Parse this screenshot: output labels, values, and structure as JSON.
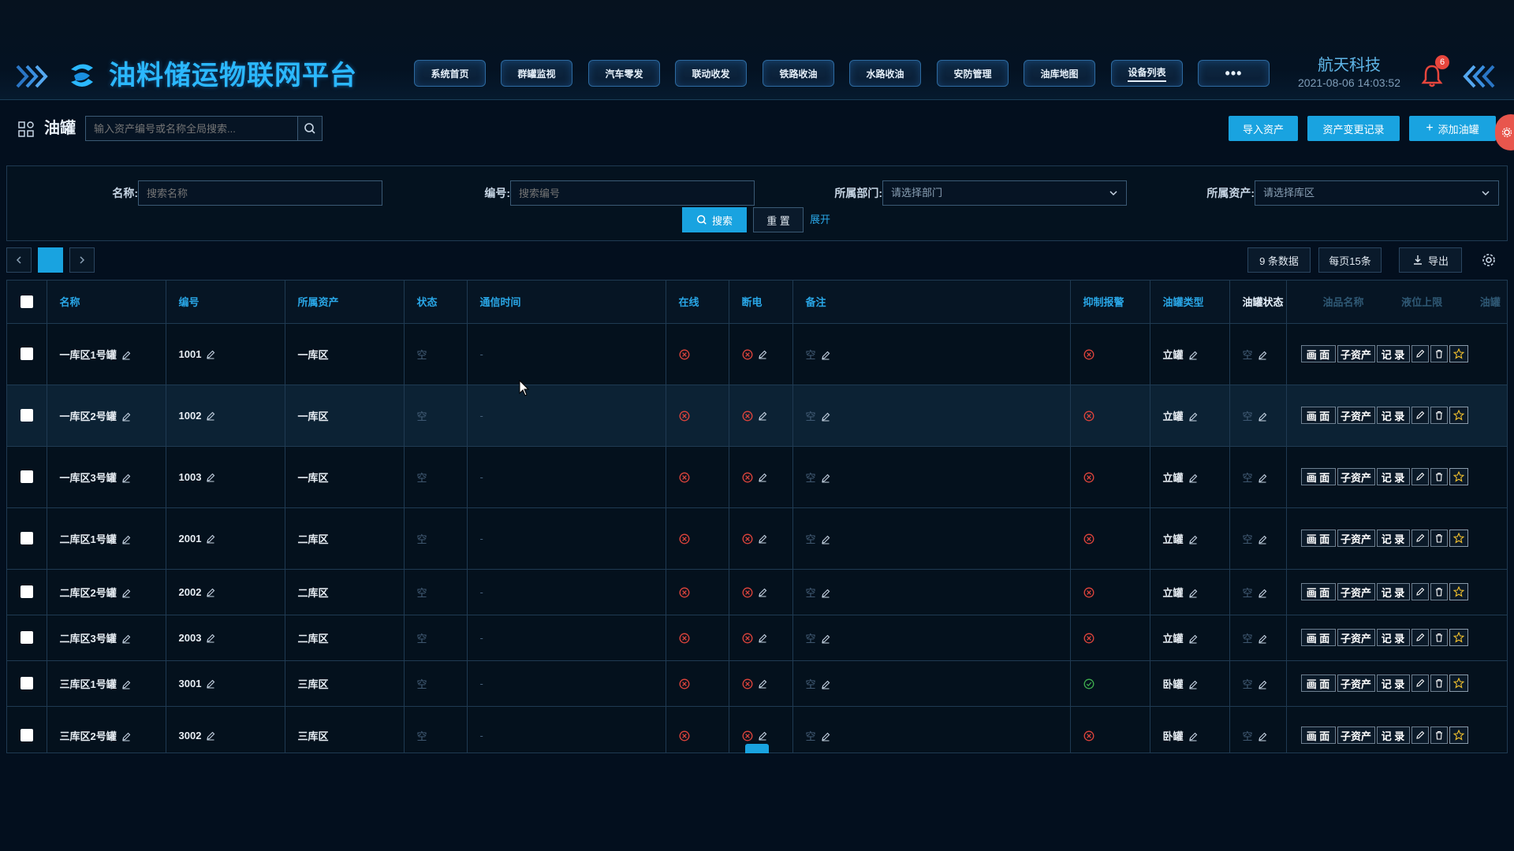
{
  "header": {
    "app_title": "油料储运物联网平台",
    "nav": [
      {
        "label": "系统首页"
      },
      {
        "label": "群罐监视"
      },
      {
        "label": "汽车零发"
      },
      {
        "label": "联动收发"
      },
      {
        "label": "铁路收油"
      },
      {
        "label": "水路收油"
      },
      {
        "label": "安防管理"
      },
      {
        "label": "油库地图"
      },
      {
        "label": "设备列表",
        "active": true
      },
      {
        "label": "•••"
      }
    ],
    "company": "航天科技",
    "datetime": "2021-08-06 14:03:52",
    "notification_count": "6"
  },
  "toolbar": {
    "page_title": "油罐",
    "global_search_placeholder": "输入资产编号或名称全局搜索...",
    "import_label": "导入资产",
    "change_log_label": "资产变更记录",
    "add_label": "添加油罐"
  },
  "filters": {
    "name_label": "名称:",
    "name_placeholder": "搜索名称",
    "code_label": "编号:",
    "code_placeholder": "搜索编号",
    "dept_label": "所属部门:",
    "dept_placeholder": "请选择部门",
    "asset_label": "所属资产:",
    "asset_placeholder": "请选择库区",
    "search_label": "搜索",
    "reset_label": "重 置",
    "expand_label": "展开"
  },
  "pager": {
    "total_label": "9 条数据",
    "page_size_label": "每页15条",
    "export_label": "导出"
  },
  "table": {
    "headers": {
      "name": "名称",
      "code": "编号",
      "asset": "所属资产",
      "status": "状态",
      "comm_time": "通信时间",
      "online": "在线",
      "power_off": "断电",
      "remark": "备注",
      "suppress_alarm": "抑制报警",
      "tank_type": "油罐类型",
      "tank_status": "油罐状态",
      "oil_name": "油品名称",
      "level_upper": "液位上限",
      "extra": "油罐"
    },
    "empty_text": "空",
    "dash_text": "-",
    "ops": {
      "screen": "画 面",
      "sub_asset": "子资产",
      "record": "记 录"
    },
    "rows": [
      {
        "name": "一库区1号罐",
        "code": "1001",
        "asset": "一库区",
        "tank_type": "立罐",
        "suppress_ok": false
      },
      {
        "name": "一库区2号罐",
        "code": "1002",
        "asset": "一库区",
        "tank_type": "立罐",
        "suppress_ok": false
      },
      {
        "name": "一库区3号罐",
        "code": "1003",
        "asset": "一库区",
        "tank_type": "立罐",
        "suppress_ok": false
      },
      {
        "name": "二库区1号罐",
        "code": "2001",
        "asset": "二库区",
        "tank_type": "立罐",
        "suppress_ok": false
      },
      {
        "name": "二库区2号罐",
        "code": "2002",
        "asset": "二库区",
        "tank_type": "立罐",
        "suppress_ok": false
      },
      {
        "name": "二库区3号罐",
        "code": "2003",
        "asset": "二库区",
        "tank_type": "立罐",
        "suppress_ok": false
      },
      {
        "name": "三库区1号罐",
        "code": "3001",
        "asset": "三库区",
        "tank_type": "卧罐",
        "suppress_ok": true
      },
      {
        "name": "三库区2号罐",
        "code": "3002",
        "asset": "三库区",
        "tank_type": "卧罐",
        "suppress_ok": false
      }
    ]
  },
  "colors": {
    "accent": "#19a3e0",
    "title_blue": "#2bb8ff",
    "error_red": "#e0443c",
    "ok_green": "#3fae4f"
  }
}
